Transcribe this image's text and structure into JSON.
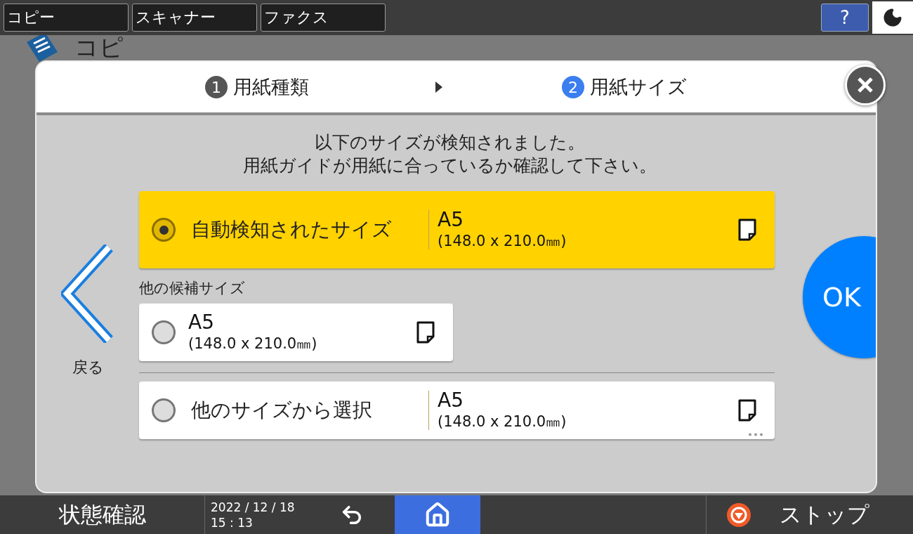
{
  "top_tabs": [
    {
      "label": "コピー"
    },
    {
      "label": "スキャナー"
    },
    {
      "label": "ファクス"
    }
  ],
  "help_button": {
    "label": "?"
  },
  "background": {
    "title": "コピ"
  },
  "dialog": {
    "steps": [
      {
        "number": "1",
        "label": "用紙種類",
        "selected": false
      },
      {
        "number": "2",
        "label": "用紙サイズ",
        "selected": true
      }
    ],
    "message": [
      "以下のサイズが検知されました。",
      "用紙ガイドが用紙に合っているか確認して下さい。"
    ],
    "back_label": "戻る",
    "detected": {
      "label": "自動検知されたサイズ",
      "size": "A5",
      "dimensions": "(148.0 x 210.0㎜)",
      "selected": true
    },
    "candidates_heading": "他の候補サイズ",
    "candidates": [
      {
        "size": "A5",
        "dimensions": "(148.0 x 210.0㎜)",
        "selected": false
      }
    ],
    "custom": {
      "label": "他のサイズから選択",
      "size": "A5",
      "dimensions": "(148.0 x 210.0㎜)",
      "selected": false
    },
    "ok_label": "OK"
  },
  "bottom_bar": {
    "status_label": "状態確認",
    "date": "2022 / 12 / 18",
    "time": "15 : 13",
    "stop_label": "ストップ"
  }
}
